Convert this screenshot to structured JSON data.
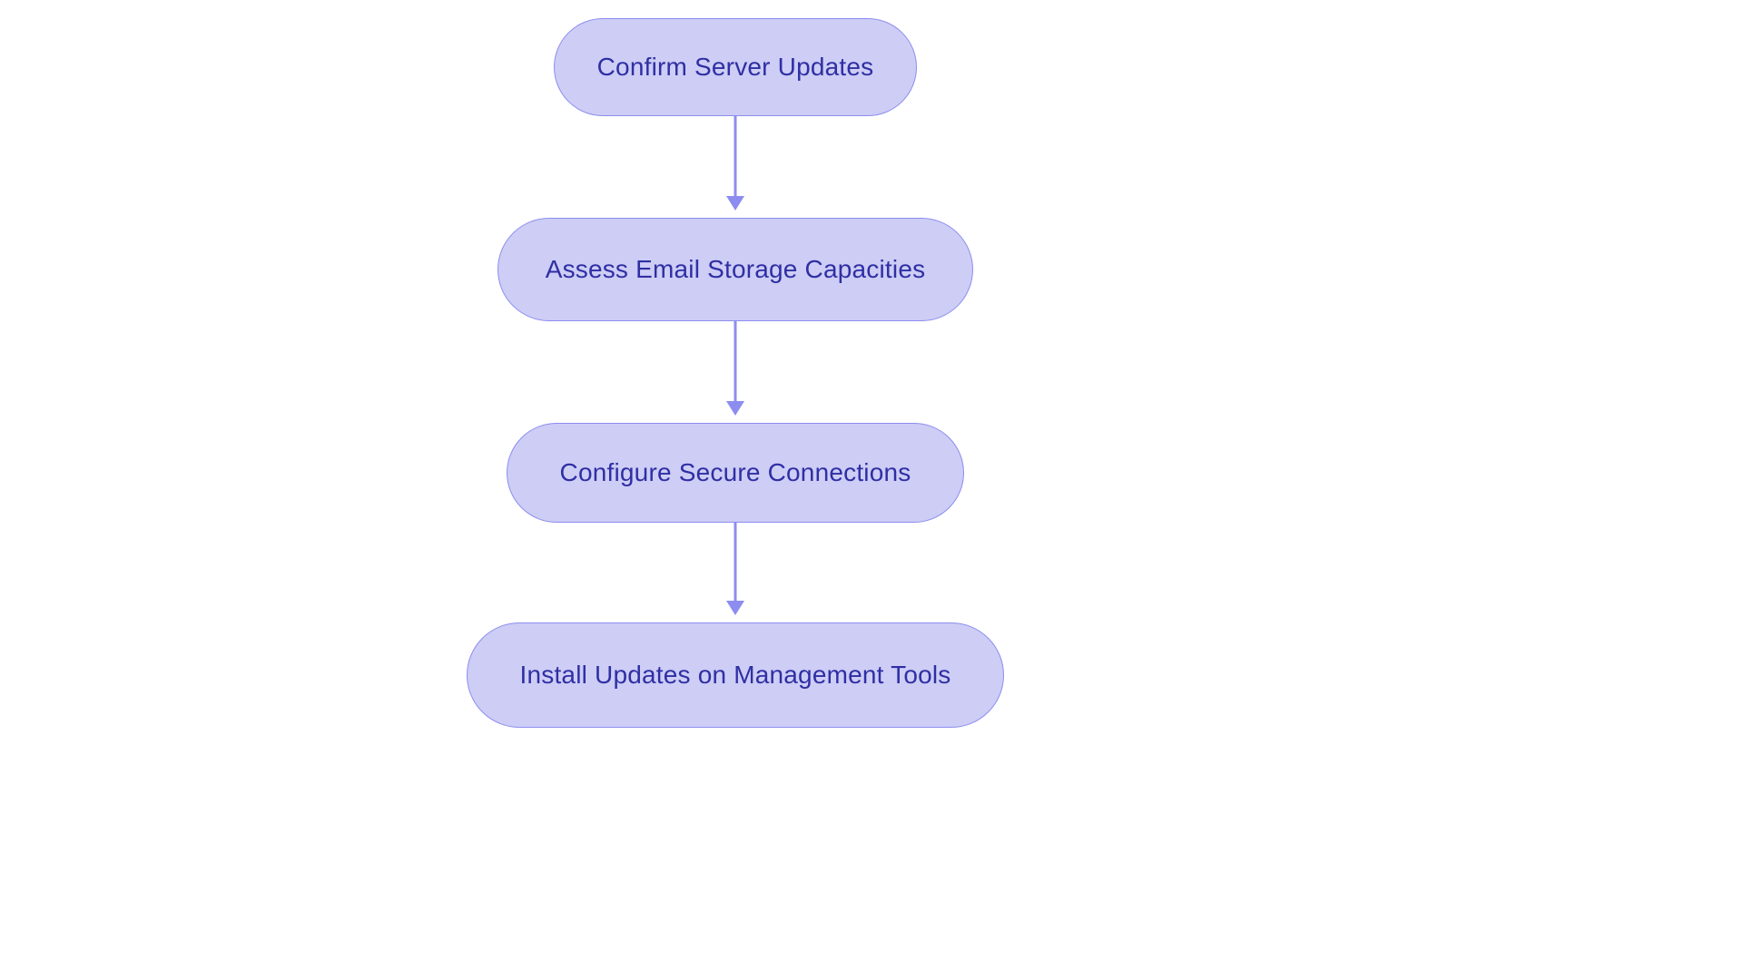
{
  "diagram": {
    "nodes": [
      {
        "label": "Confirm Server Updates"
      },
      {
        "label": "Assess Email Storage Capacities"
      },
      {
        "label": "Configure Secure Connections"
      },
      {
        "label": "Install Updates on Management Tools"
      }
    ]
  },
  "colors": {
    "node_fill": "#cdcdf6",
    "node_border": "#8d8df0",
    "text": "#2f2fa4",
    "arrow": "#8d8df0"
  },
  "chart_data": {
    "type": "flowchart",
    "direction": "top-to-bottom",
    "nodes": [
      "Confirm Server Updates",
      "Assess Email Storage Capacities",
      "Configure Secure Connections",
      "Install Updates on Management Tools"
    ],
    "edges": [
      {
        "from": 0,
        "to": 1
      },
      {
        "from": 1,
        "to": 2
      },
      {
        "from": 2,
        "to": 3
      }
    ]
  }
}
